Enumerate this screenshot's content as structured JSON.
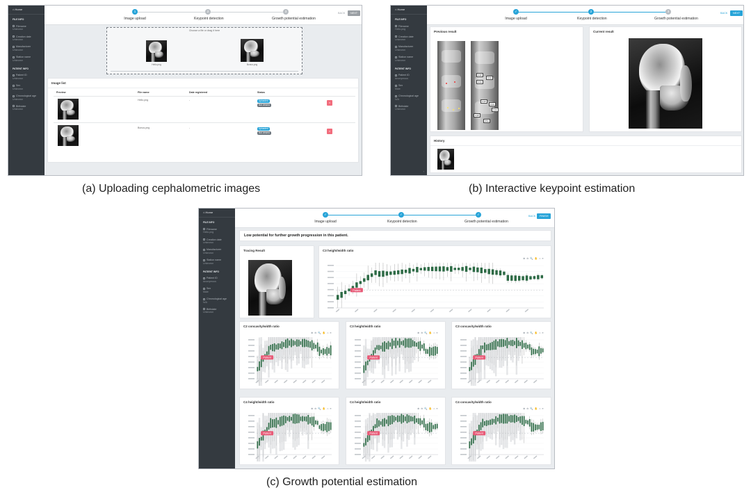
{
  "captions": {
    "a": "(a) Uploading cephalometric images",
    "b": "(b) Interactive keypoint estimation",
    "c": "(c) Growth potential estimation"
  },
  "sidebar": {
    "home": "Home",
    "file_info": "FILE INFO",
    "patient_info": "PATIENT INFO",
    "items_a": [
      {
        "label": "Filename",
        "value": "Unknown"
      },
      {
        "label": "Creation date",
        "value": "Unknown"
      },
      {
        "label": "Manufacturer",
        "value": "Unknown"
      },
      {
        "label": "Station name",
        "value": "Unknown"
      }
    ],
    "items_a_patient": [
      {
        "label": "Patient ID",
        "value": "Unknown"
      },
      {
        "label": "Sex",
        "value": "Unknown"
      },
      {
        "label": "Chronological age",
        "value": "Unknown"
      },
      {
        "label": "Birthdate",
        "value": "Unknown"
      }
    ],
    "items_b": [
      {
        "label": "Filename",
        "value": "Hello.png"
      },
      {
        "label": "Creation date",
        "value": "Unknown"
      },
      {
        "label": "Manufacturer",
        "value": "Unknown"
      },
      {
        "label": "Station name",
        "value": "Unknown"
      }
    ],
    "items_b_patient": [
      {
        "label": "Patient ID",
        "value": "Anonymous"
      },
      {
        "label": "Sex",
        "value": "Male"
      },
      {
        "label": "Chronological age",
        "value": "N/A"
      },
      {
        "label": "Birthdate",
        "value": "Unknown"
      }
    ],
    "items_c": [
      {
        "label": "Filename",
        "value": "Hello.png"
      },
      {
        "label": "Creation date",
        "value": "Unknown"
      },
      {
        "label": "Manufacturer",
        "value": "Unknown"
      },
      {
        "label": "Station name",
        "value": "Unknown"
      }
    ],
    "items_c_patient": [
      {
        "label": "Patient ID",
        "value": "Anonymous"
      },
      {
        "label": "Sex",
        "value": "Male"
      },
      {
        "label": "Chronological age",
        "value": "N/A"
      },
      {
        "label": "Birthdate",
        "value": "Unknown"
      }
    ],
    "collapse": "‹"
  },
  "steps": {
    "upload": "Image upload",
    "keypoint": "Keypoint detection",
    "growth": "Growth potential estimation",
    "n1": "1",
    "n2": "2",
    "n3": "3"
  },
  "buttons": {
    "back": "BACK",
    "next": "NEXT",
    "finish": "FINISH"
  },
  "panel_a": {
    "dropzone": "Choose a file or drag it here",
    "thumb1": "Hello.png",
    "thumb2": "Bonus.png",
    "image_list": "Image list",
    "cols": [
      "Preview",
      "File name",
      "Date registered",
      "Status"
    ],
    "rows": [
      {
        "name": "Hello.png",
        "date": "-",
        "status1": "Uploaded",
        "status2": "Not viewed"
      },
      {
        "name": "Bonus.png",
        "date": "-",
        "status1": "Uploaded",
        "status2": "Not viewed"
      }
    ],
    "delete": "×"
  },
  "panel_b": {
    "previous": "Previous result",
    "current": "Current result",
    "history": "History",
    "kp_labels": [
      "C3P",
      "C3A",
      "C3A",
      "C4P",
      "C4A",
      "C4A",
      "C4P",
      "C5A"
    ]
  },
  "panel_c": {
    "banner": "Low potential for further growth progression in this patient.",
    "tracing": "Tracing Result",
    "toolbar_icons": "⊕ ⊖ 🔍 ✋ ⌂ ≡",
    "patient_tag": "Patient"
  },
  "chart_data": [
    {
      "type": "box",
      "title": "C3 height/width ratio",
      "main": true
    },
    {
      "type": "box",
      "title": "C2 concavity/width ratio"
    },
    {
      "type": "box",
      "title": "C3 height/width ratio"
    },
    {
      "type": "box",
      "title": "C3 concavity/width ratio"
    },
    {
      "type": "box",
      "title": "C4 height/width ratio"
    },
    {
      "type": "box",
      "title": "C4 height/width ratio"
    },
    {
      "type": "box",
      "title": "C4 concavity/width ratio"
    }
  ],
  "colors": {
    "sidebar": "#343a40",
    "accent": "#28a4d8",
    "box": "#2e6b46",
    "tag": "#e85a77"
  }
}
